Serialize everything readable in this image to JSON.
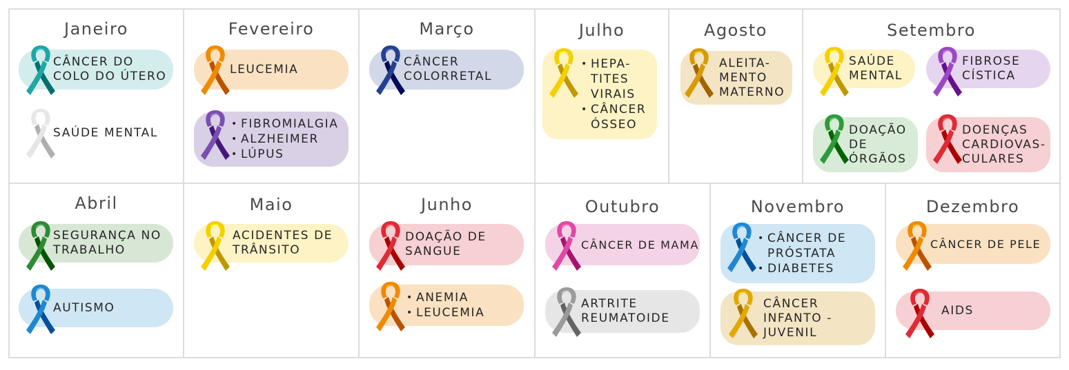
{
  "months": {
    "jan": {
      "name": "Janeiro",
      "items": [
        {
          "text": "Câncer do colo do útero",
          "color": "#1fa7a6",
          "bg": "#d3ecec"
        },
        {
          "text": "Saúde mental",
          "color": "#e6e6e6",
          "bg": "#ffffff"
        }
      ]
    },
    "feb": {
      "name": "Fevereiro",
      "items": [
        {
          "text": "Leucemia",
          "color": "#f08a00",
          "bg": "#f9e1c2"
        },
        {
          "list": [
            "Fibromialgia",
            "Alzheimer",
            "Lúpus"
          ],
          "color": "#7b4fb0",
          "bg": "#d9d0e6"
        }
      ]
    },
    "mar": {
      "name": "Março",
      "items": [
        {
          "text": "Câncer colorretal",
          "color": "#24418f",
          "bg": "#d2d8e8"
        }
      ]
    },
    "jul": {
      "name": "Julho",
      "items": [
        {
          "list": [
            "Hepa-tites virais",
            "Câncer ósseo"
          ],
          "color": "#f5d000",
          "bg": "#fdf3c4"
        }
      ]
    },
    "aug": {
      "name": "Agosto",
      "items": [
        {
          "text": "Aleita-mento materno",
          "color": "#d89a00",
          "bg": "#f3e4c3"
        }
      ]
    },
    "sep": {
      "name": "Setembro",
      "items": [
        {
          "text": "Saúde mental",
          "color": "#f5d000",
          "bg": "#fdf3c4"
        },
        {
          "text": "Fibrose cística",
          "color": "#9b48c4",
          "bg": "#e6d5ee"
        },
        {
          "text": "Doação de órgãos",
          "color": "#2e9a3a",
          "bg": "#d7ebd6"
        },
        {
          "text": "Doenças cardiovas-culares",
          "color": "#e02a35",
          "bg": "#f6d0d2"
        }
      ]
    },
    "apr": {
      "name": "Abril",
      "items": [
        {
          "text": "Segurança no trabalho",
          "color": "#2e8b34",
          "bg": "#d7e6d5"
        },
        {
          "text": "Autismo",
          "color": "#1f88d0",
          "bg": "#cfe6f4"
        }
      ]
    },
    "may": {
      "name": "Maio",
      "items": [
        {
          "text": "Acidentes de trânsito",
          "color": "#f5d000",
          "bg": "#fdf3c4"
        }
      ]
    },
    "jun": {
      "name": "Junho",
      "items": [
        {
          "text": "Doação de sangue",
          "color": "#e02a35",
          "bg": "#f6d0d2"
        },
        {
          "list": [
            "Anemia",
            "Leucemia"
          ],
          "color": "#f08a00",
          "bg": "#f9e1c2"
        }
      ]
    },
    "oct": {
      "name": "Outubro",
      "items": [
        {
          "text": "Câncer de mama",
          "color": "#de4aa6",
          "bg": "#f4d3e6"
        },
        {
          "text": "Artrite reumatoide",
          "color": "#9a9a9a",
          "bg": "#e6e6e6"
        }
      ]
    },
    "nov": {
      "name": "Novembro",
      "items": [
        {
          "list": [
            "Câncer de próstata",
            "Diabetes"
          ],
          "color": "#1f88d0",
          "bg": "#cfe6f4"
        },
        {
          "text": "Câncer infanto - juvenil",
          "color": "#e2a800",
          "bg": "#f3e4c3"
        }
      ]
    },
    "dec": {
      "name": "Dezembro",
      "items": [
        {
          "text": "Câncer de pele",
          "color": "#f08a00",
          "bg": "#f9e1c2"
        },
        {
          "text": "AIDS",
          "color": "#e02a35",
          "bg": "#f6d0d2"
        }
      ]
    }
  }
}
